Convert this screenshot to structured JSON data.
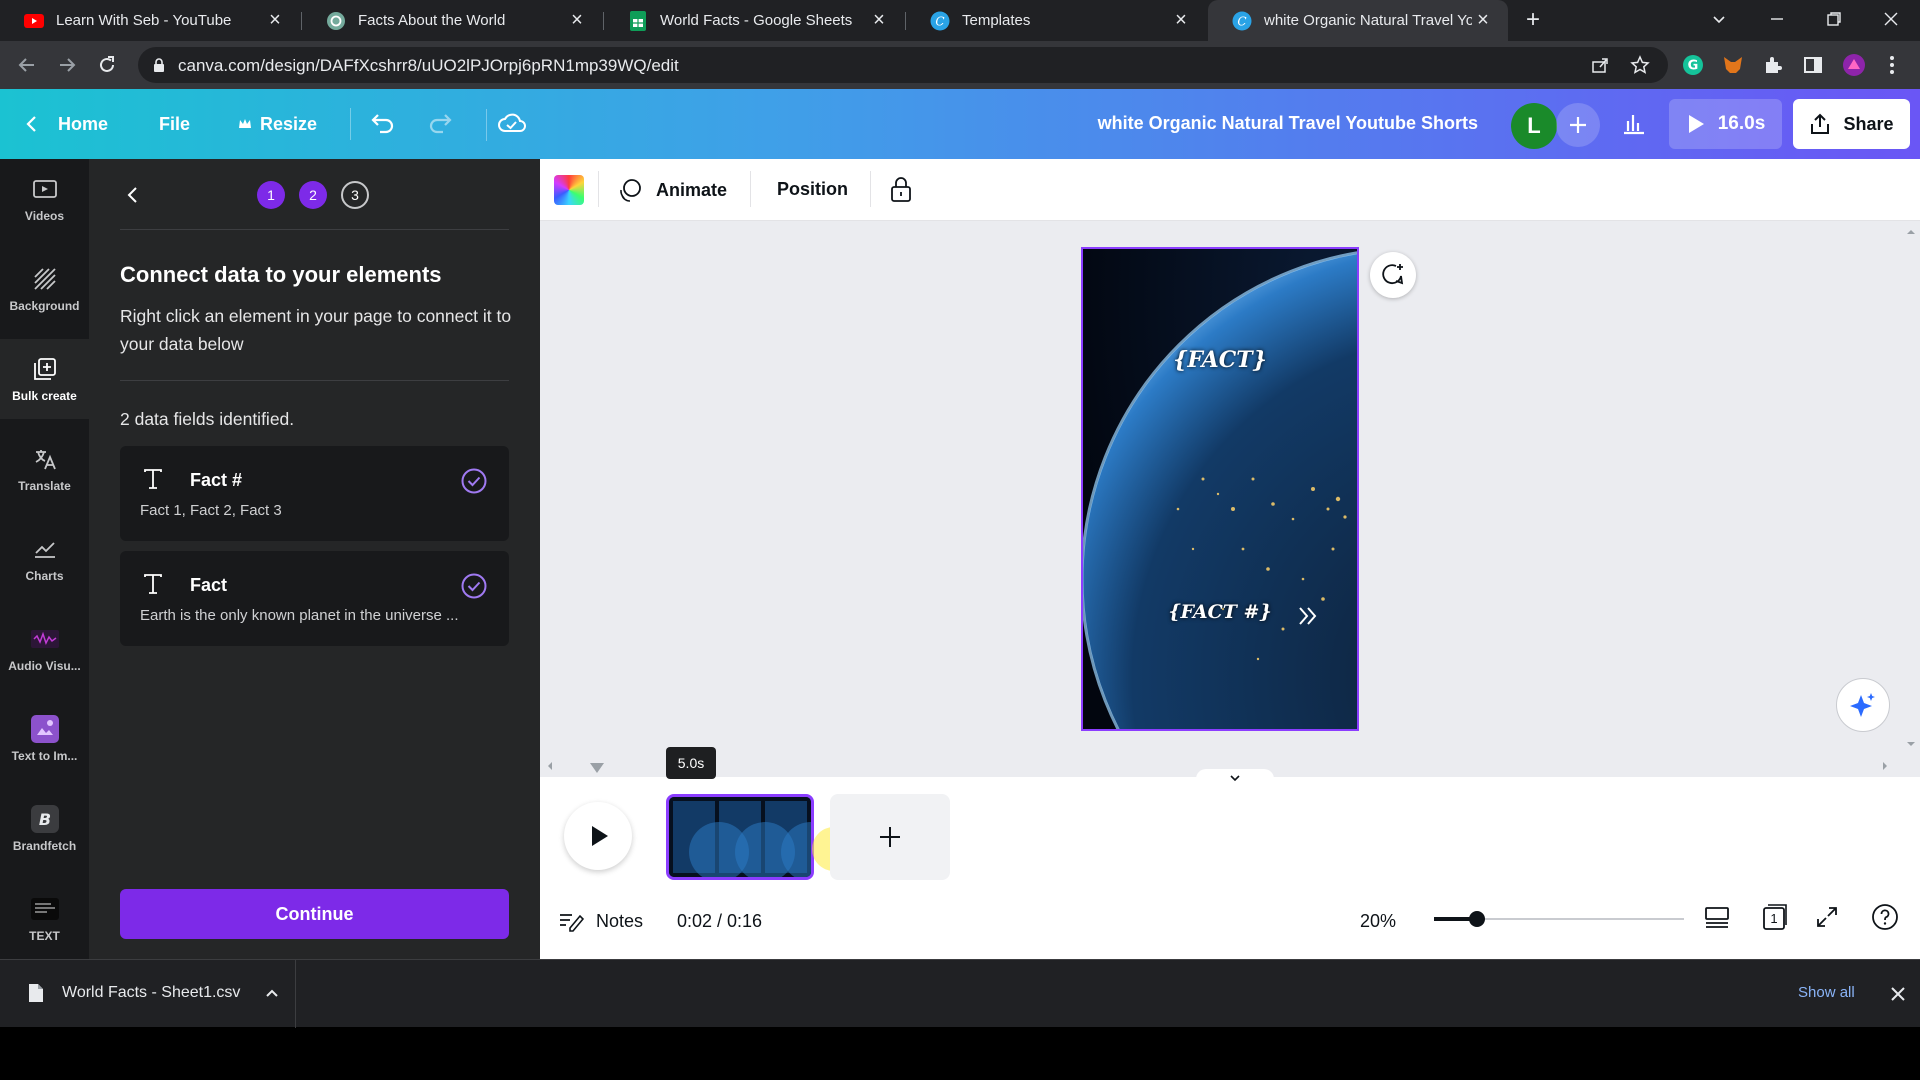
{
  "browser": {
    "tabs": [
      {
        "title": "Learn With Seb - YouTube",
        "icon": "youtube-icon"
      },
      {
        "title": "Facts About the World",
        "icon": "chatgpt-icon"
      },
      {
        "title": "World Facts - Google Sheets",
        "icon": "sheets-icon"
      },
      {
        "title": "Templates",
        "icon": "canva-icon"
      },
      {
        "title": "white Organic Natural Travel Youtube Shorts",
        "icon": "canva-icon"
      }
    ],
    "url": "canva.com/design/DAFfXcshrr8/uUO2lPJOrpj6pRN1mp39WQ/edit"
  },
  "header": {
    "home": "Home",
    "file": "File",
    "resize": "Resize",
    "doc_title": "white Organic Natural Travel Youtube Shorts",
    "avatar_initial": "L",
    "play_duration": "16.0s",
    "share": "Share"
  },
  "rail": [
    {
      "label": "Videos",
      "icon": "video-icon"
    },
    {
      "label": "Background",
      "icon": "background-icon"
    },
    {
      "label": "Bulk create",
      "icon": "bulk-create-icon"
    },
    {
      "label": "Translate",
      "icon": "translate-icon"
    },
    {
      "label": "Charts",
      "icon": "chart-icon"
    },
    {
      "label": "Audio Visu...",
      "icon": "audio-visualizer-icon"
    },
    {
      "label": "Text to Im...",
      "icon": "text-to-image-icon"
    },
    {
      "label": "Brandfetch",
      "icon": "brandfetch-icon"
    },
    {
      "label": "TEXT",
      "icon": "text-app-icon"
    }
  ],
  "panel": {
    "steps": [
      "1",
      "2",
      "3"
    ],
    "title": "Connect data to your elements",
    "description": "Right click an element in your page to connect it to your data below",
    "fields_count": "2 data fields identified.",
    "fields": [
      {
        "name": "Fact #",
        "values": "Fact 1, Fact 2, Fact 3"
      },
      {
        "name": "Fact",
        "values": "Earth is the only known planet in the universe ..."
      }
    ],
    "continue": "Continue"
  },
  "toolbar": {
    "animate": "Animate",
    "position": "Position"
  },
  "page": {
    "fact_text": "{FACT}",
    "fact_num_text": "{FACT #}"
  },
  "timeline": {
    "duration_tooltip": "5.0s",
    "notes": "Notes",
    "time": "0:02 / 0:16",
    "zoom": "20%",
    "zoom_level": 0.17,
    "page_count": "1"
  },
  "download": {
    "file": "World Facts - Sheet1.csv",
    "show_all": "Show all"
  }
}
